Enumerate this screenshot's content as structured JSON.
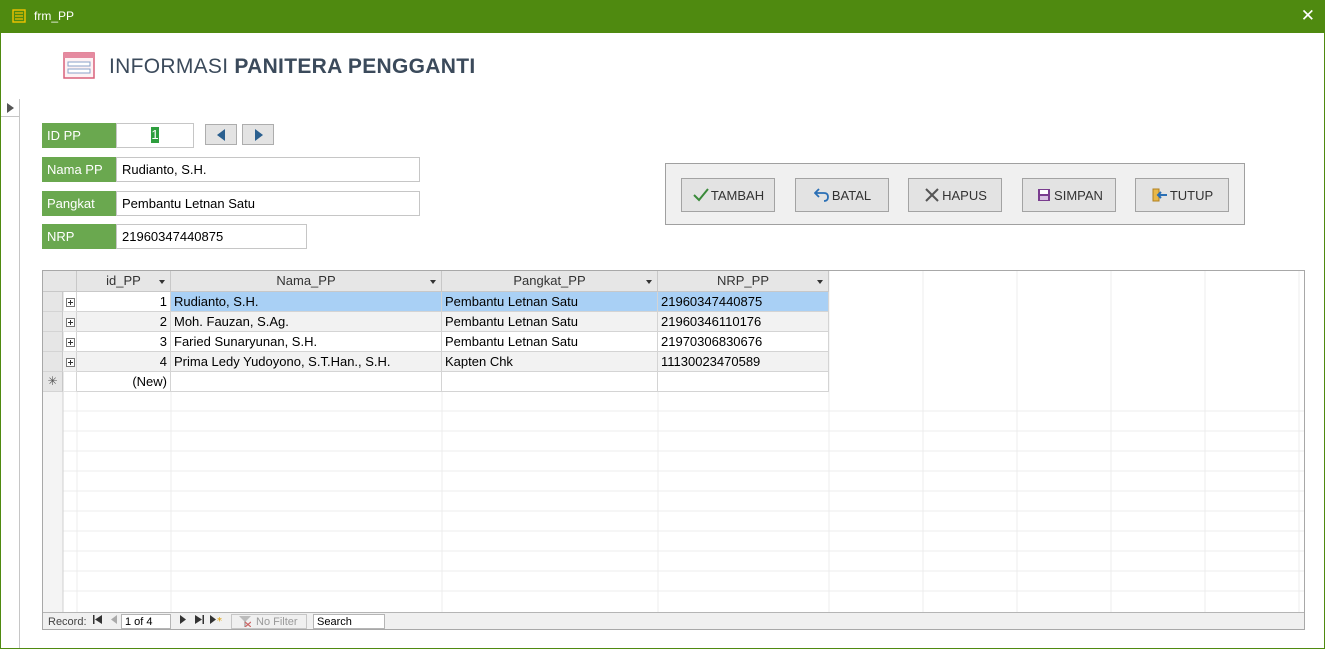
{
  "window": {
    "title": "frm_PP",
    "close_glyph": "✕",
    "frame_color": "#4f8a10"
  },
  "header": {
    "title_light": "INFORMASI",
    "title_bold": "PANITERA PENGGANTI",
    "icon": "form-icon"
  },
  "fields": {
    "id_label": "ID PP",
    "id_value": "1",
    "nama_label": "Nama PP",
    "nama_value": "Rudianto, S.H.",
    "pangkat_label": "Pangkat",
    "pangkat_value": "Pembantu Letnan Satu",
    "nrp_label": "NRP",
    "nrp_value": "21960347440875",
    "label_color": "#6aa84f"
  },
  "actions": {
    "tambah": "TAMBAH",
    "batal": "BATAL",
    "hapus": "HAPUS",
    "simpan": "SIMPAN",
    "tutup": "TUTUP"
  },
  "grid": {
    "columns": [
      "id_PP",
      "Nama_PP",
      "Pangkat_PP",
      "NRP_PP"
    ],
    "rows": [
      {
        "id": "1",
        "nama": "Rudianto, S.H.",
        "pangkat": "Pembantu Letnan Satu",
        "nrp": "21960347440875"
      },
      {
        "id": "2",
        "nama": "Moh. Fauzan, S.Ag.",
        "pangkat": "Pembantu Letnan Satu",
        "nrp": "21960346110176"
      },
      {
        "id": "3",
        "nama": "Faried Sunaryunan, S.H.",
        "pangkat": "Pembantu Letnan Satu",
        "nrp": "21970306830676"
      },
      {
        "id": "4",
        "nama": "Prima Ledy Yudoyono, S.T.Han., S.H.",
        "pangkat": "Kapten Chk",
        "nrp": "11130023470589"
      }
    ],
    "new_row_label": "(New)",
    "new_row_marker": "✳",
    "selected_color": "#a9d0f5"
  },
  "navigation": {
    "record_label": "Record:",
    "record_position": "1 of 4",
    "filter_label": "No Filter",
    "search_value": "Search"
  }
}
